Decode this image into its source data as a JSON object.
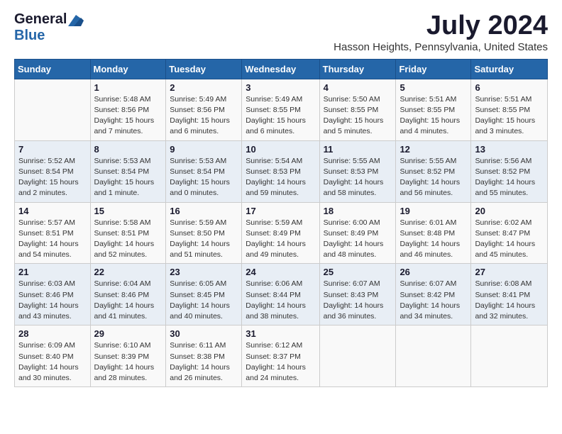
{
  "header": {
    "logo_general": "General",
    "logo_blue": "Blue",
    "month_title": "July 2024",
    "location": "Hasson Heights, Pennsylvania, United States"
  },
  "calendar": {
    "days_of_week": [
      "Sunday",
      "Monday",
      "Tuesday",
      "Wednesday",
      "Thursday",
      "Friday",
      "Saturday"
    ],
    "weeks": [
      [
        {
          "day": "",
          "info": ""
        },
        {
          "day": "1",
          "info": "Sunrise: 5:48 AM\nSunset: 8:56 PM\nDaylight: 15 hours\nand 7 minutes."
        },
        {
          "day": "2",
          "info": "Sunrise: 5:49 AM\nSunset: 8:56 PM\nDaylight: 15 hours\nand 6 minutes."
        },
        {
          "day": "3",
          "info": "Sunrise: 5:49 AM\nSunset: 8:55 PM\nDaylight: 15 hours\nand 6 minutes."
        },
        {
          "day": "4",
          "info": "Sunrise: 5:50 AM\nSunset: 8:55 PM\nDaylight: 15 hours\nand 5 minutes."
        },
        {
          "day": "5",
          "info": "Sunrise: 5:51 AM\nSunset: 8:55 PM\nDaylight: 15 hours\nand 4 minutes."
        },
        {
          "day": "6",
          "info": "Sunrise: 5:51 AM\nSunset: 8:55 PM\nDaylight: 15 hours\nand 3 minutes."
        }
      ],
      [
        {
          "day": "7",
          "info": "Sunrise: 5:52 AM\nSunset: 8:54 PM\nDaylight: 15 hours\nand 2 minutes."
        },
        {
          "day": "8",
          "info": "Sunrise: 5:53 AM\nSunset: 8:54 PM\nDaylight: 15 hours\nand 1 minute."
        },
        {
          "day": "9",
          "info": "Sunrise: 5:53 AM\nSunset: 8:54 PM\nDaylight: 15 hours\nand 0 minutes."
        },
        {
          "day": "10",
          "info": "Sunrise: 5:54 AM\nSunset: 8:53 PM\nDaylight: 14 hours\nand 59 minutes."
        },
        {
          "day": "11",
          "info": "Sunrise: 5:55 AM\nSunset: 8:53 PM\nDaylight: 14 hours\nand 58 minutes."
        },
        {
          "day": "12",
          "info": "Sunrise: 5:55 AM\nSunset: 8:52 PM\nDaylight: 14 hours\nand 56 minutes."
        },
        {
          "day": "13",
          "info": "Sunrise: 5:56 AM\nSunset: 8:52 PM\nDaylight: 14 hours\nand 55 minutes."
        }
      ],
      [
        {
          "day": "14",
          "info": "Sunrise: 5:57 AM\nSunset: 8:51 PM\nDaylight: 14 hours\nand 54 minutes."
        },
        {
          "day": "15",
          "info": "Sunrise: 5:58 AM\nSunset: 8:51 PM\nDaylight: 14 hours\nand 52 minutes."
        },
        {
          "day": "16",
          "info": "Sunrise: 5:59 AM\nSunset: 8:50 PM\nDaylight: 14 hours\nand 51 minutes."
        },
        {
          "day": "17",
          "info": "Sunrise: 5:59 AM\nSunset: 8:49 PM\nDaylight: 14 hours\nand 49 minutes."
        },
        {
          "day": "18",
          "info": "Sunrise: 6:00 AM\nSunset: 8:49 PM\nDaylight: 14 hours\nand 48 minutes."
        },
        {
          "day": "19",
          "info": "Sunrise: 6:01 AM\nSunset: 8:48 PM\nDaylight: 14 hours\nand 46 minutes."
        },
        {
          "day": "20",
          "info": "Sunrise: 6:02 AM\nSunset: 8:47 PM\nDaylight: 14 hours\nand 45 minutes."
        }
      ],
      [
        {
          "day": "21",
          "info": "Sunrise: 6:03 AM\nSunset: 8:46 PM\nDaylight: 14 hours\nand 43 minutes."
        },
        {
          "day": "22",
          "info": "Sunrise: 6:04 AM\nSunset: 8:46 PM\nDaylight: 14 hours\nand 41 minutes."
        },
        {
          "day": "23",
          "info": "Sunrise: 6:05 AM\nSunset: 8:45 PM\nDaylight: 14 hours\nand 40 minutes."
        },
        {
          "day": "24",
          "info": "Sunrise: 6:06 AM\nSunset: 8:44 PM\nDaylight: 14 hours\nand 38 minutes."
        },
        {
          "day": "25",
          "info": "Sunrise: 6:07 AM\nSunset: 8:43 PM\nDaylight: 14 hours\nand 36 minutes."
        },
        {
          "day": "26",
          "info": "Sunrise: 6:07 AM\nSunset: 8:42 PM\nDaylight: 14 hours\nand 34 minutes."
        },
        {
          "day": "27",
          "info": "Sunrise: 6:08 AM\nSunset: 8:41 PM\nDaylight: 14 hours\nand 32 minutes."
        }
      ],
      [
        {
          "day": "28",
          "info": "Sunrise: 6:09 AM\nSunset: 8:40 PM\nDaylight: 14 hours\nand 30 minutes."
        },
        {
          "day": "29",
          "info": "Sunrise: 6:10 AM\nSunset: 8:39 PM\nDaylight: 14 hours\nand 28 minutes."
        },
        {
          "day": "30",
          "info": "Sunrise: 6:11 AM\nSunset: 8:38 PM\nDaylight: 14 hours\nand 26 minutes."
        },
        {
          "day": "31",
          "info": "Sunrise: 6:12 AM\nSunset: 8:37 PM\nDaylight: 14 hours\nand 24 minutes."
        },
        {
          "day": "",
          "info": ""
        },
        {
          "day": "",
          "info": ""
        },
        {
          "day": "",
          "info": ""
        }
      ]
    ]
  }
}
